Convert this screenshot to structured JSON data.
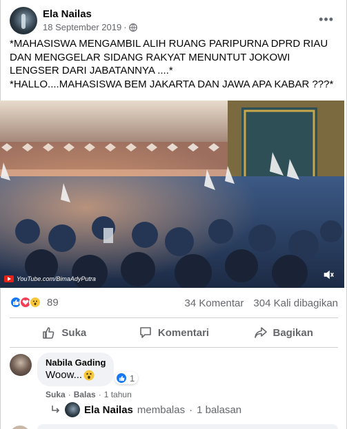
{
  "post": {
    "author": "Ela Nailas",
    "date": "18 September 2019",
    "separator": "·",
    "text_lines": [
      "*MAHASISWA MENGAMBIL ALIH RUANG PARIPURNA DPRD RIAU DAN MENGGELAR SIDANG RAKYAT MENUNTUT JOKOWI LENGSER DARI JABATANNYA ....*",
      "*HALLO....MAHASISWA BEM JAKARTA DAN JAWA APA KABAR ???*"
    ],
    "video_watermark": "YouTube.com/BimaAdyPutra"
  },
  "stats": {
    "reaction_count": "89",
    "comments": "34 Komentar",
    "shares": "304 Kali dibagikan",
    "reaction_icons": [
      "like-icon",
      "love-icon",
      "wow-icon"
    ]
  },
  "actions": {
    "like": "Suka",
    "comment": "Komentari",
    "share": "Bagikan"
  },
  "comment": {
    "author": "Nabila Gading",
    "text": "Woow...",
    "reaction_count": "1",
    "like_label": "Suka",
    "reply_label": "Balas",
    "dot": "·",
    "time": "1 tahun",
    "reply_author": "Ela Nailas",
    "reply_action": "membalas",
    "reply_count": "1 balasan"
  },
  "colors": {
    "brand": "#1877f2",
    "text_secondary": "#65676b",
    "love": "#f33e58",
    "wow": "#f7c73b"
  }
}
